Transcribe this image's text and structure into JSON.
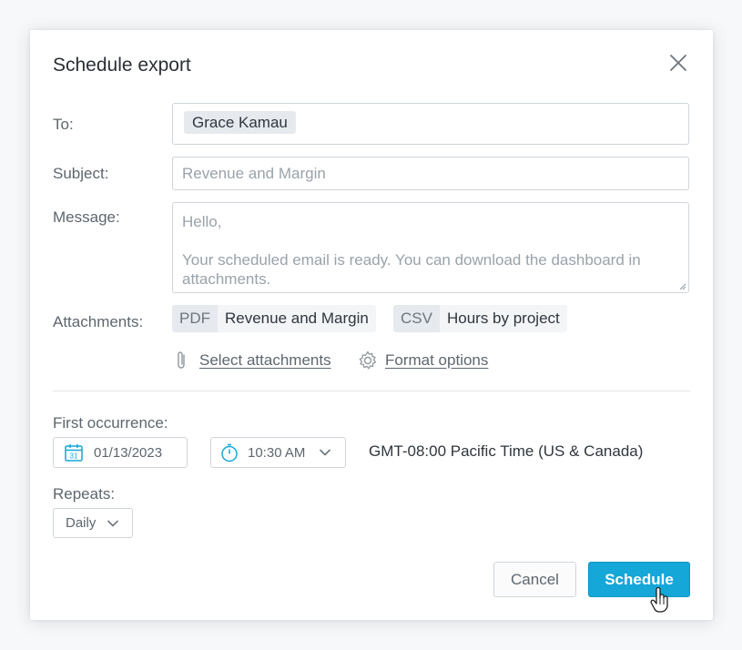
{
  "dialog": {
    "title": "Schedule export",
    "close_icon": "close-icon"
  },
  "form": {
    "to_label": "To:",
    "recipients": [
      "Grace Kamau"
    ],
    "subject_label": "Subject:",
    "subject_placeholder": "Revenue and Margin",
    "message_label": "Message:",
    "message_text": "Hello,\n\nYour scheduled email is ready. You can download the dashboard in attachments.",
    "attachments_label": "Attachments:",
    "attachments": [
      {
        "format": "PDF",
        "name": "Revenue and Margin"
      },
      {
        "format": "CSV",
        "name": "Hours by project"
      }
    ],
    "select_attachments": "Select attachments",
    "format_options": "Format options"
  },
  "schedule": {
    "first_occurrence_label": "First occurrence:",
    "date": "01/13/2023",
    "time": "10:30 AM",
    "timezone": "GMT-08:00 Pacific Time (US & Canada)",
    "repeats_label": "Repeats:",
    "repeats": "Daily"
  },
  "buttons": {
    "cancel": "Cancel",
    "schedule": "Schedule"
  },
  "colors": {
    "accent": "#14a7d8",
    "chip_bg": "#e6e9ed",
    "border": "#cfd5db"
  }
}
